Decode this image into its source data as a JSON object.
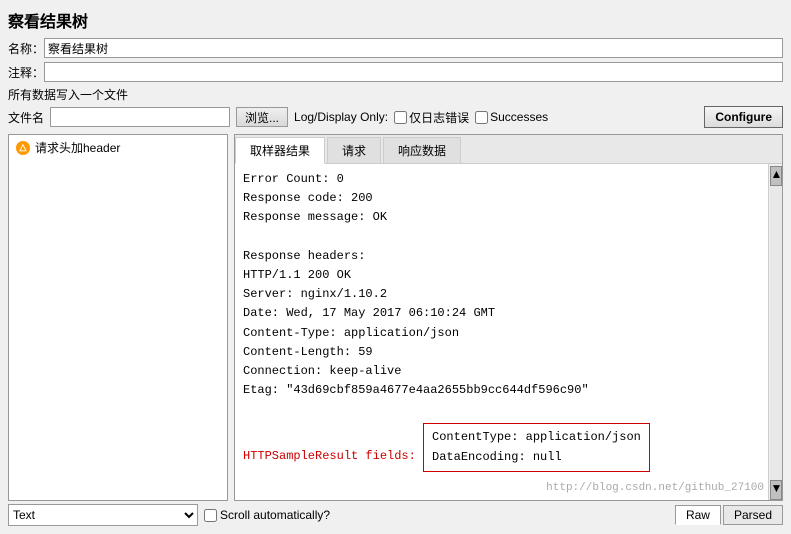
{
  "title": "察看结果树",
  "form": {
    "name_label": "名称：",
    "name_value": "察看结果树",
    "comment_label": "注释：",
    "comment_value": ""
  },
  "file_section": {
    "title": "所有数据写入一个文件",
    "file_label": "文件名",
    "file_value": "",
    "browse_label": "浏览...",
    "log_display_label": "Log/Display Only:",
    "checkbox1_label": "仅日志错误",
    "checkbox2_label": "Successes",
    "configure_label": "Configure"
  },
  "tree": {
    "items": [
      {
        "label": "请求头加header",
        "icon": "warning"
      }
    ]
  },
  "tabs": {
    "items": [
      "取样器结果",
      "请求",
      "响应数据"
    ],
    "active": 0
  },
  "content": {
    "lines": [
      "Error Count: 0",
      "Response code: 200",
      "Response message: OK",
      "",
      "Response headers:",
      "HTTP/1.1 200 OK",
      "Server: nginx/1.10.2",
      "Date: Wed, 17 May 2017 06:10:24 GMT",
      "Content-Type: application/json",
      "Content-Length: 59",
      "Connection: keep-alive",
      "Etag: \"43d69cbf859a4677e4aa2655bb9cc644df596c90\""
    ],
    "http_fields_label": "HTTPSampleResult fields:",
    "http_fields": [
      "ContentType: application/json",
      "DataEncoding: null"
    ]
  },
  "bottom": {
    "text_dropdown_value": "Text",
    "scroll_label": "Scroll automatically?",
    "raw_label": "Raw",
    "parsed_label": "Parsed",
    "watermark": "http://blog.csdn.net/github_27100"
  }
}
